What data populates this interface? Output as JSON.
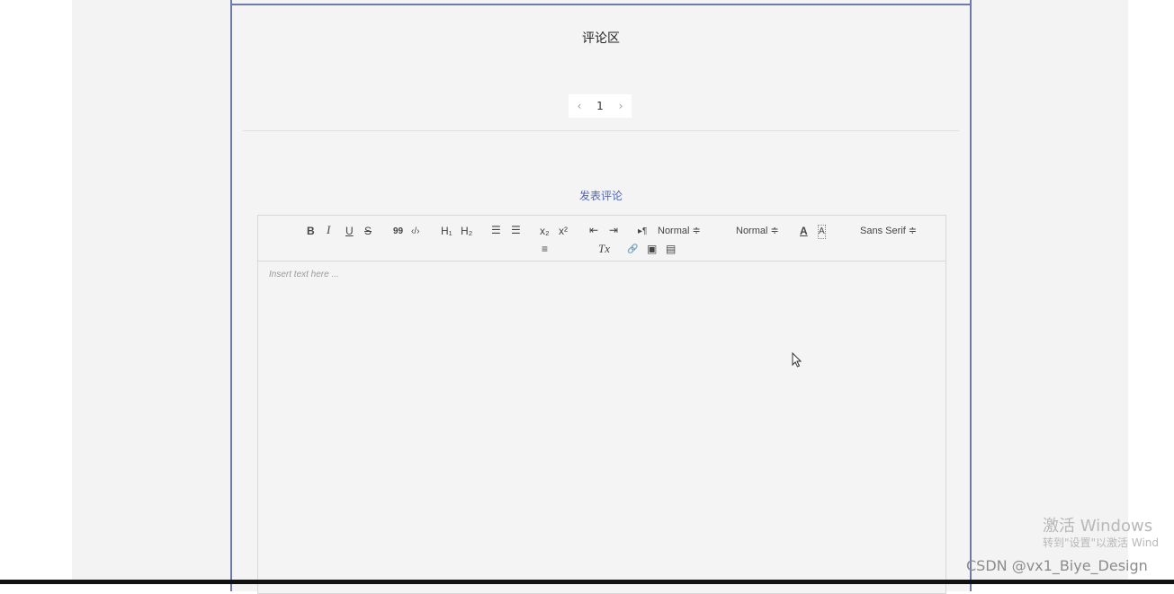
{
  "comments": {
    "title": "评论区",
    "pagination": {
      "prev": "‹",
      "current": "1",
      "next": "›"
    }
  },
  "post": {
    "label": "发表评论",
    "editor": {
      "toolbar": {
        "bold": "B",
        "italic": "I",
        "underline": "U",
        "strike": "S",
        "blockquote": "99",
        "code": "‹/›",
        "h1": "H₁",
        "h2": "H₂",
        "ordered_list": "☰",
        "bullet_list": "☰",
        "subscript": "x₂",
        "superscript": "x²",
        "outdent": "⇤",
        "indent": "⇥",
        "direction": "▸¶",
        "size_select": "Normal ≑",
        "header_select": "Normal ≑",
        "color": "A",
        "background": "A",
        "font_select": "Sans Serif ≑",
        "align": "≡",
        "clean": "Tx",
        "link": "🔗",
        "image": "▣",
        "video": "▤"
      },
      "placeholder": "Insert text here ..."
    }
  },
  "watermark": {
    "activate_title": "激活 Windows",
    "activate_sub": "转到\"设置\"以激活 Wind",
    "csdn": "CSDN @vx1_Biye_Design"
  },
  "colors": {
    "accent": "#4f63b5",
    "border": "#6e7aa8",
    "background": "#f4f4f4"
  }
}
